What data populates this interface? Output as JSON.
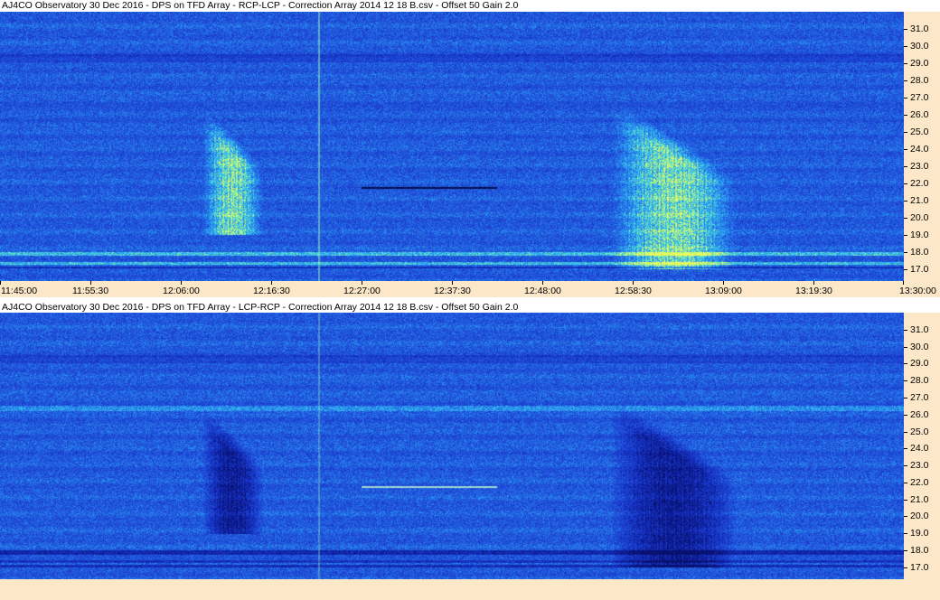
{
  "window": {
    "title_top": "AJ4CO Observatory 30 Dec 2016  -  DPS on TFD Array  -  RCP-LCP  -  Correction Array 2014 12 18 B.csv  -  Offset 50  Gain 2.0",
    "title_bottom": "AJ4CO Observatory 30 Dec 2016  -  DPS on TFD Array  -  LCP-RCP  -  Correction Array 2014 12 18 B.csv  -  Offset 50  Gain 2.0"
  },
  "colors": {
    "axis_background": "#fde7c9",
    "spectrogram_base": "#1f4fd8",
    "bright_emission": "#8ef0a0",
    "dark_emission": "#0a1680"
  },
  "chart_data": [
    {
      "type": "heatmap",
      "title": "AJ4CO Observatory 30 Dec 2016  -  DPS on TFD Array  -  RCP-LCP  -  Correction Array 2014 12 18 B.csv  -  Offset 50  Gain 2.0",
      "polarization": "RCP-LCP",
      "emission_polarity": "bright",
      "x_ticks": [
        "11:45:00",
        "11:55:30",
        "12:06:00",
        "12:16:30",
        "12:27:00",
        "12:37:30",
        "12:48:00",
        "12:58:30",
        "13:09:00",
        "13:19:30",
        "13:30:00"
      ],
      "y_ticks": [
        "17.0",
        "18.0",
        "19.0",
        "20.0",
        "21.0",
        "22.0",
        "23.0",
        "24.0",
        "25.0",
        "26.0",
        "27.0",
        "28.0",
        "29.0",
        "30.0",
        "31.0"
      ],
      "xlim": [
        "11:45:00",
        "13:30:00"
      ],
      "ylim": [
        16.3,
        32.0
      ],
      "emission_events": [
        {
          "start": "12:08:30",
          "end": "12:15:30",
          "freq_low": 19.0,
          "freq_high": 26.5
        },
        {
          "start": "12:56:00",
          "end": "13:10:30",
          "freq_low": 17.0,
          "freq_high": 27.0
        }
      ]
    },
    {
      "type": "heatmap",
      "title": "AJ4CO Observatory 30 Dec 2016  -  DPS on TFD Array  -  LCP-RCP  -  Correction Array 2014 12 18 B.csv  -  Offset 50  Gain 2.0",
      "polarization": "LCP-RCP",
      "emission_polarity": "dark",
      "x_ticks": [],
      "y_ticks": [
        "17.0",
        "18.0",
        "19.0",
        "20.0",
        "21.0",
        "22.0",
        "23.0",
        "24.0",
        "25.0",
        "26.0",
        "27.0",
        "28.0",
        "29.0",
        "30.0",
        "31.0"
      ],
      "xlim": [
        "11:45:00",
        "13:30:00"
      ],
      "ylim": [
        16.3,
        32.0
      ],
      "emission_events": [
        {
          "start": "12:08:30",
          "end": "12:15:30",
          "freq_low": 19.0,
          "freq_high": 26.5
        },
        {
          "start": "12:56:00",
          "end": "13:10:30",
          "freq_low": 17.0,
          "freq_high": 27.0
        }
      ]
    }
  ]
}
